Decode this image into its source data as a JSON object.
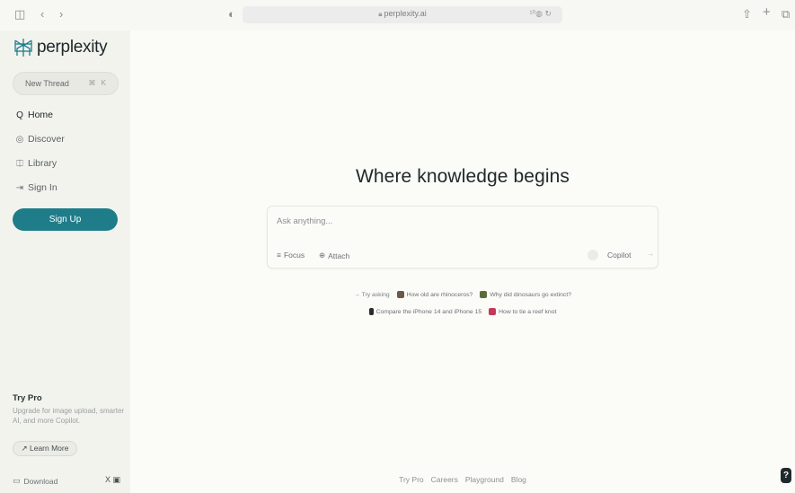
{
  "browser": {
    "url": "perplexity.ai",
    "sidebar_toggle_glyph": "◫",
    "back_glyph": "‹",
    "forward_glyph": "›",
    "shield_glyph": "◐",
    "url_right": "¹⁰◍ ↻",
    "share_glyph": "⇧",
    "new_tab_glyph": "+",
    "tabs_glyph": "⧉"
  },
  "sidebar": {
    "logo_text": "perplexity",
    "new_thread_label": "New Thread",
    "new_thread_shortcut": "⌘ K",
    "nav": [
      {
        "label": "Home",
        "icon": "search-icon",
        "glyph": "Q"
      },
      {
        "label": "Discover",
        "icon": "compass-icon",
        "glyph": "◎"
      },
      {
        "label": "Library",
        "icon": "library-icon",
        "glyph": "⎅"
      },
      {
        "label": "Sign In",
        "icon": "sign-in-icon",
        "glyph": "⇥"
      }
    ],
    "signup_label": "Sign Up",
    "try_pro_title": "Try Pro",
    "try_pro_desc": "Upgrade for image upload, smarter AI, and more Copilot.",
    "learn_more_label": "↗ Learn More",
    "download_label": "Download",
    "social_glyphs": "X ▣"
  },
  "main": {
    "headline": "Where knowledge begins",
    "ask_placeholder": "Ask anything...",
    "focus_label": "Focus",
    "attach_label": "Attach",
    "copilot_label": "Copilot",
    "try_asking": "→ Try asking",
    "suggestions_row1": [
      {
        "label": "How old are rhinoceros?",
        "color": "#6b5a4a"
      },
      {
        "label": "Why did dinosaurs go extinct?",
        "color": "#5c6b3a"
      }
    ],
    "suggestions_row2": [
      {
        "label": "Compare the iPhone 14 and iPhone 15",
        "color": "#2b2b2b"
      },
      {
        "label": "How to tie a reef knot",
        "color": "#c23a5a"
      }
    ],
    "footer_links": [
      "Try Pro",
      "Careers",
      "Playground",
      "Blog"
    ],
    "help_label": "?"
  },
  "colors": {
    "accent": "#1f7d8a",
    "sidebar_bg": "#f3f3ee",
    "main_bg": "#fbfbf8"
  }
}
